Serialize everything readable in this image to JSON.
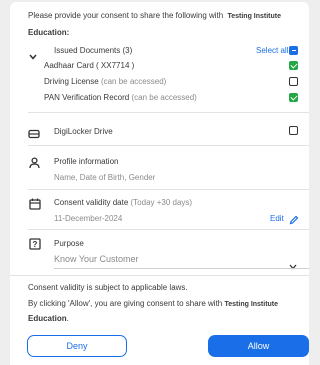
{
  "header": {
    "prompt": "Please provide your consent to share the following with",
    "org_part1": "Testing Institute",
    "org_part2": "Education:"
  },
  "issued_documents": {
    "label": "Issued Documents (3)",
    "select_all": "Select all",
    "items": [
      {
        "name": "Aadhaar Card ( XX7714 )",
        "note": "",
        "checked": true
      },
      {
        "name": "Driving License",
        "note": "(can be accessed)",
        "checked": false
      },
      {
        "name": "PAN Verification Record",
        "note": "(can be accessed)",
        "checked": true
      }
    ]
  },
  "digilocker": {
    "label": "DigiLocker Drive",
    "checked": false
  },
  "profile": {
    "label": "Profile information",
    "details": "Name, Date of Birth, Gender"
  },
  "validity": {
    "label": "Consent validity date",
    "hint": "(Today +30 days)",
    "date": "11-December-2024",
    "edit": "Edit"
  },
  "purpose": {
    "label": "Purpose",
    "value": "Know Your Customer"
  },
  "footer": {
    "line1": "Consent validity is subject to applicable laws.",
    "line2": "By clicking 'Allow', you are giving consent to share with",
    "org1": "Testing Institute",
    "org2": "Education",
    "end": "."
  },
  "buttons": {
    "deny": "Deny",
    "allow": "Allow"
  },
  "colors": {
    "accent": "#1a6fe8",
    "check": "#21a744"
  }
}
